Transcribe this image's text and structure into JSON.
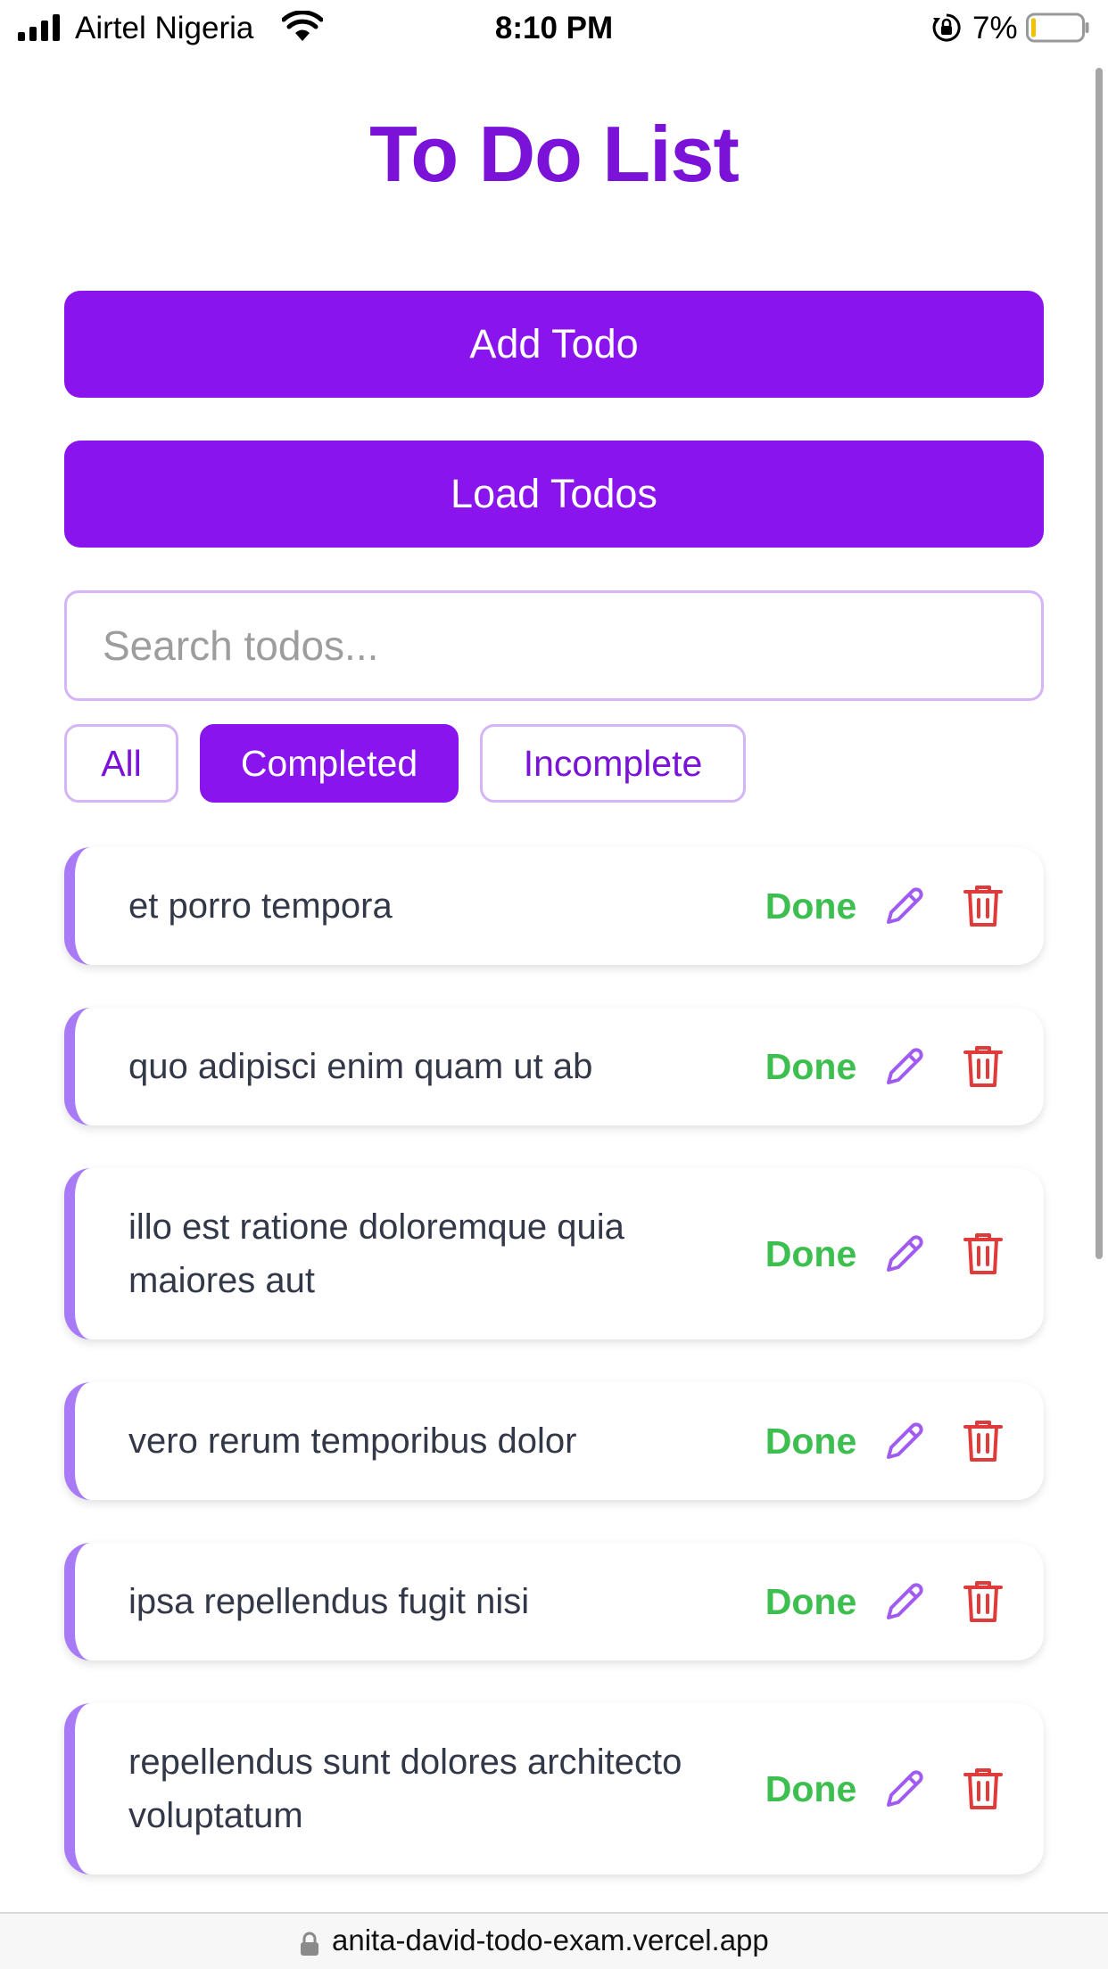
{
  "status_bar": {
    "carrier": "Airtel Nigeria",
    "time": "8:10 PM",
    "battery": "7%",
    "icons": [
      "signal-icon",
      "wifi-icon",
      "orientation-lock-icon",
      "battery-icon"
    ]
  },
  "header": {
    "title": "To Do List"
  },
  "actions": {
    "add_label": "Add Todo",
    "load_label": "Load Todos"
  },
  "search": {
    "placeholder": "Search todos..."
  },
  "filters": [
    {
      "label": "All",
      "active": false
    },
    {
      "label": "Completed",
      "active": true
    },
    {
      "label": "Incomplete",
      "active": false
    }
  ],
  "todos": [
    {
      "text": "et porro tempora",
      "status": "Done"
    },
    {
      "text": "quo adipisci enim quam ut ab",
      "status": "Done"
    },
    {
      "text": "illo est ratione doloremque quia maiores aut",
      "status": "Done"
    },
    {
      "text": "vero rerum temporibus dolor",
      "status": "Done"
    },
    {
      "text": "ipsa repellendus fugit nisi",
      "status": "Done"
    },
    {
      "text": "repellendus sunt dolores architecto voluptatum",
      "status": "Done"
    }
  ],
  "colors": {
    "accent": "#8a14ee",
    "title": "#7a12d8",
    "done": "#3cbf4e",
    "delete": "#e03b3b",
    "edit": "#a05cf0"
  },
  "url_bar": {
    "url": "anita-david-todo-exam.vercel.app"
  }
}
